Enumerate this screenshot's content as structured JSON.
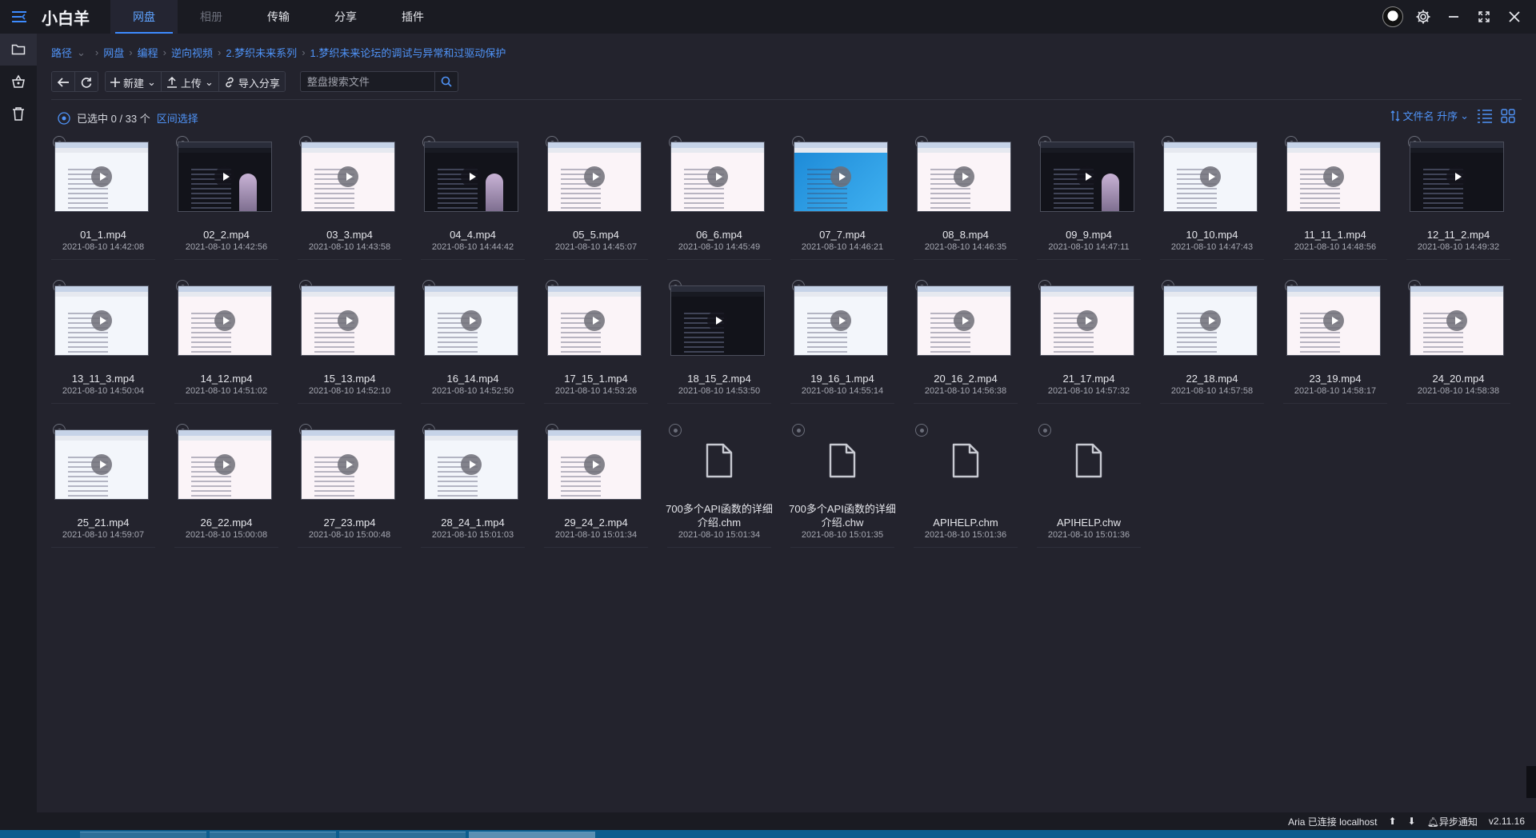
{
  "app": {
    "title": "小白羊"
  },
  "nav": {
    "tabs": [
      {
        "label": "网盘",
        "active": true
      },
      {
        "label": "相册",
        "dim": true
      },
      {
        "label": "传输"
      },
      {
        "label": "分享"
      },
      {
        "label": "插件"
      }
    ]
  },
  "breadcrumb": {
    "root": "路径",
    "items": [
      "网盘",
      "编程",
      "逆向视频",
      "2.梦织未来系列",
      "1.梦织未来论坛的调试与异常和过驱动保护"
    ]
  },
  "toolbar": {
    "new_label": "新建",
    "upload_label": "上传",
    "import_share_label": "导入分享",
    "search_placeholder": "整盘搜索文件"
  },
  "selection": {
    "text": "已选中 0 / 33 个",
    "range_label": "区间选择"
  },
  "sort": {
    "label": "文件名 升序"
  },
  "files": [
    {
      "name": "01_1.mp4",
      "date": "2021-08-10 14:42:08",
      "type": "video",
      "theme": "light"
    },
    {
      "name": "02_2.mp4",
      "date": "2021-08-10 14:42:56",
      "type": "video",
      "theme": "dark"
    },
    {
      "name": "03_3.mp4",
      "date": "2021-08-10 14:43:58",
      "type": "video",
      "theme": "light"
    },
    {
      "name": "04_4.mp4",
      "date": "2021-08-10 14:44:42",
      "type": "video",
      "theme": "dark"
    },
    {
      "name": "05_5.mp4",
      "date": "2021-08-10 14:45:07",
      "type": "video",
      "theme": "light"
    },
    {
      "name": "06_6.mp4",
      "date": "2021-08-10 14:45:49",
      "type": "video",
      "theme": "light"
    },
    {
      "name": "07_7.mp4",
      "date": "2021-08-10 14:46:21",
      "type": "video",
      "theme": "blue"
    },
    {
      "name": "08_8.mp4",
      "date": "2021-08-10 14:46:35",
      "type": "video",
      "theme": "light"
    },
    {
      "name": "09_9.mp4",
      "date": "2021-08-10 14:47:11",
      "type": "video",
      "theme": "dark"
    },
    {
      "name": "10_10.mp4",
      "date": "2021-08-10 14:47:43",
      "type": "video",
      "theme": "light"
    },
    {
      "name": "11_11_1.mp4",
      "date": "2021-08-10 14:48:56",
      "type": "video",
      "theme": "light"
    },
    {
      "name": "12_11_2.mp4",
      "date": "2021-08-10 14:49:32",
      "type": "video",
      "theme": "dark"
    },
    {
      "name": "13_11_3.mp4",
      "date": "2021-08-10 14:50:04",
      "type": "video",
      "theme": "light"
    },
    {
      "name": "14_12.mp4",
      "date": "2021-08-10 14:51:02",
      "type": "video",
      "theme": "light"
    },
    {
      "name": "15_13.mp4",
      "date": "2021-08-10 14:52:10",
      "type": "video",
      "theme": "light"
    },
    {
      "name": "16_14.mp4",
      "date": "2021-08-10 14:52:50",
      "type": "video",
      "theme": "light"
    },
    {
      "name": "17_15_1.mp4",
      "date": "2021-08-10 14:53:26",
      "type": "video",
      "theme": "light"
    },
    {
      "name": "18_15_2.mp4",
      "date": "2021-08-10 14:53:50",
      "type": "video",
      "theme": "dark"
    },
    {
      "name": "19_16_1.mp4",
      "date": "2021-08-10 14:55:14",
      "type": "video",
      "theme": "light"
    },
    {
      "name": "20_16_2.mp4",
      "date": "2021-08-10 14:56:38",
      "type": "video",
      "theme": "light"
    },
    {
      "name": "21_17.mp4",
      "date": "2021-08-10 14:57:32",
      "type": "video",
      "theme": "light"
    },
    {
      "name": "22_18.mp4",
      "date": "2021-08-10 14:57:58",
      "type": "video",
      "theme": "light"
    },
    {
      "name": "23_19.mp4",
      "date": "2021-08-10 14:58:17",
      "type": "video",
      "theme": "light"
    },
    {
      "name": "24_20.mp4",
      "date": "2021-08-10 14:58:38",
      "type": "video",
      "theme": "light"
    },
    {
      "name": "25_21.mp4",
      "date": "2021-08-10 14:59:07",
      "type": "video",
      "theme": "light"
    },
    {
      "name": "26_22.mp4",
      "date": "2021-08-10 15:00:08",
      "type": "video",
      "theme": "light"
    },
    {
      "name": "27_23.mp4",
      "date": "2021-08-10 15:00:48",
      "type": "video",
      "theme": "light"
    },
    {
      "name": "28_24_1.mp4",
      "date": "2021-08-10 15:01:03",
      "type": "video",
      "theme": "light"
    },
    {
      "name": "29_24_2.mp4",
      "date": "2021-08-10 15:01:34",
      "type": "video",
      "theme": "light"
    },
    {
      "name": "700多个API函数的详细介绍.chm",
      "date": "2021-08-10 15:01:34",
      "type": "file"
    },
    {
      "name": "700多个API函数的详细介绍.chw",
      "date": "2021-08-10 15:01:35",
      "type": "file"
    },
    {
      "name": "APIHELP.chm",
      "date": "2021-08-10 15:01:36",
      "type": "file"
    },
    {
      "name": "APIHELP.chw",
      "date": "2021-08-10 15:01:36",
      "type": "file"
    }
  ],
  "status": {
    "aria": "Aria 已连接 localhost",
    "notify": "异步通知",
    "version": "v2.11.16"
  },
  "colors": {
    "accent": "#3d8bff",
    "link": "#4f93f7",
    "background": "#23232d",
    "chrome": "#1a1b22"
  },
  "icons": [
    "menu-icon",
    "avatar",
    "gear-icon",
    "minimize-icon",
    "maximize-icon",
    "close-icon",
    "folder-icon",
    "basket-icon",
    "trash-icon",
    "back-icon",
    "refresh-icon",
    "plus-icon",
    "upload-icon",
    "link-icon",
    "search-icon",
    "sort-icon",
    "list-view-icon",
    "grid-view-icon",
    "play-icon",
    "file-icon"
  ]
}
